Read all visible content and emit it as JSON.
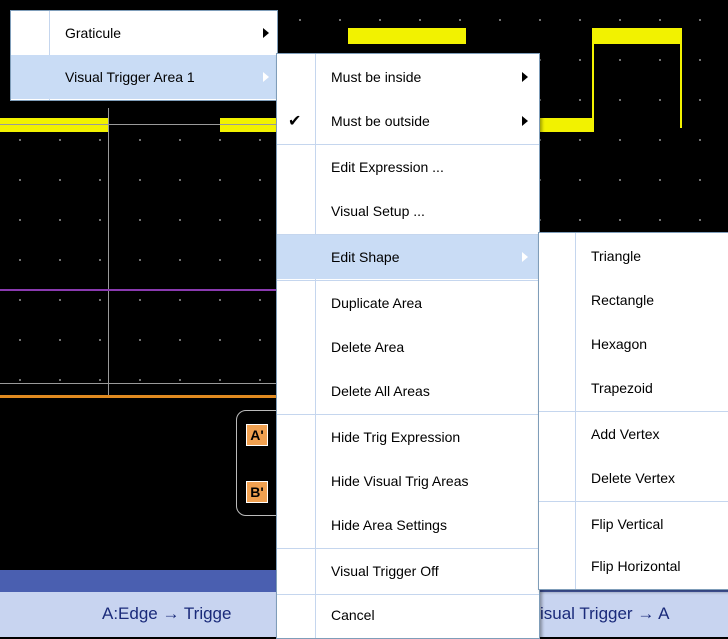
{
  "colors": {
    "trace": "#f2f200",
    "menu_highlight": "#c9dcf5",
    "menu_border": "#7f9db9",
    "status_text": "#1a2a7a"
  },
  "menu_top": {
    "items": [
      {
        "label": "Graticule"
      },
      {
        "label": "Visual Trigger Area 1"
      }
    ]
  },
  "menu_main": {
    "items": [
      {
        "label": "Must be inside"
      },
      {
        "label": "Must be outside",
        "checked": true
      },
      {
        "label": "Edit Expression ..."
      },
      {
        "label": "Visual Setup ..."
      },
      {
        "label": "Edit Shape"
      },
      {
        "label": "Duplicate Area"
      },
      {
        "label": "Delete Area"
      },
      {
        "label": "Delete All Areas"
      },
      {
        "label": "Hide Trig Expression"
      },
      {
        "label": "Hide Visual Trig Areas"
      },
      {
        "label": "Hide Area Settings"
      },
      {
        "label": "Visual Trigger Off"
      },
      {
        "label": "Cancel"
      }
    ]
  },
  "menu_shape": {
    "items": [
      {
        "label": "Triangle"
      },
      {
        "label": "Rectangle"
      },
      {
        "label": "Hexagon"
      },
      {
        "label": "Trapezoid"
      },
      {
        "label": "Add Vertex"
      },
      {
        "label": "Delete Vertex"
      },
      {
        "label": "Flip Vertical"
      },
      {
        "label": "Flip Horizontal"
      }
    ]
  },
  "markers": {
    "a_prime": "A'",
    "b_prime": "B'"
  },
  "status": {
    "left": "A:Edge → Trigge",
    "right": "isual Trigger → A"
  },
  "checkmark": "✔"
}
